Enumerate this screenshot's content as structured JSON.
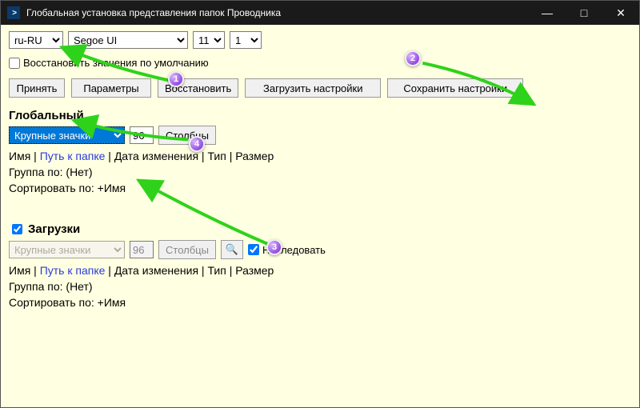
{
  "window": {
    "title": "Глобальная установка представления папок Проводника"
  },
  "top": {
    "lang": "ru-RU",
    "font": "Segoe UI",
    "size": "11",
    "scale": "1",
    "restore_defaults": "Восстановить значения по умолчанию"
  },
  "buttons": {
    "accept": "Принять",
    "options": "Параметры",
    "restore": "Восстановить",
    "load": "Загрузить настройки",
    "save": "Сохранить настройки",
    "columns": "Столбцы"
  },
  "global": {
    "title": "Глобальный",
    "view": "Крупные значки",
    "icon_size": "96",
    "columns_line": {
      "name": "Имя",
      "path": "Путь к папке",
      "modified": "Дата изменения",
      "type": "Тип",
      "size": "Размер"
    },
    "group_by": "Группа по: (Нет)",
    "sort_by": "Сортировать по: +Имя"
  },
  "downloads": {
    "title": "Загрузки",
    "view": "Крупные значки",
    "icon_size": "96",
    "inherit": "Наследовать",
    "columns_line": {
      "name": "Имя",
      "path": "Путь к папке",
      "modified": "Дата изменения",
      "type": "Тип",
      "size": "Размер"
    },
    "group_by": "Группа по: (Нет)",
    "sort_by": "Сортировать по: +Имя"
  },
  "badges": {
    "b1": "1",
    "b2": "2",
    "b3": "3",
    "b4": "4"
  }
}
